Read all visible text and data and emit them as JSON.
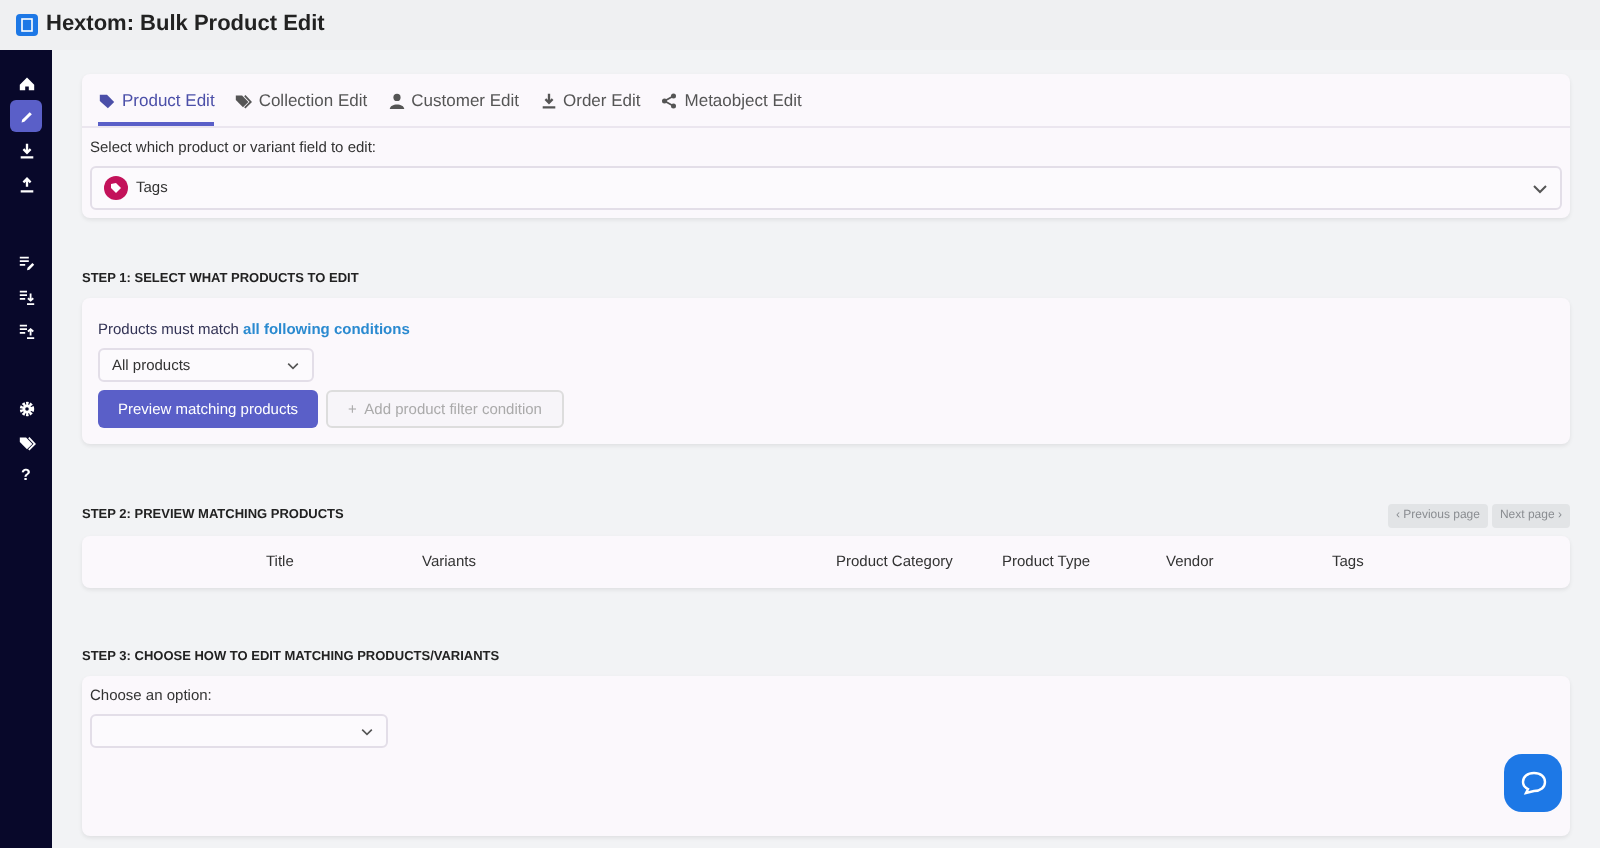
{
  "window": {
    "title": "Hextom: Bulk Product Edit"
  },
  "sidebar": {
    "items": [
      {
        "selected": false
      },
      {
        "selected": true
      },
      {
        "selected": false
      },
      {
        "selected": false
      },
      {
        "selected": false
      },
      {
        "selected": false
      },
      {
        "selected": false
      },
      {
        "selected": false
      },
      {
        "selected": false
      },
      {
        "selected": false,
        "text": "?"
      }
    ]
  },
  "tabs": [
    {
      "label": "Product Edit",
      "selected": true
    },
    {
      "label": "Collection Edit",
      "selected": false
    },
    {
      "label": "Customer Edit",
      "selected": false
    },
    {
      "label": "Order Edit",
      "selected": false
    },
    {
      "label": "Metaobject Edit",
      "selected": false
    }
  ],
  "field_picker": {
    "label": "Select which product or variant field to edit:",
    "value": "Tags"
  },
  "step1": {
    "heading": "STEP 1: SELECT WHAT PRODUCTS TO EDIT",
    "match_text": "Products must match **all following conditions**",
    "filter": "All products",
    "preview_button": "Preview matching products",
    "add_condition": {
      "label": "Add product filter condition",
      "icon": "+",
      "disabled": true
    }
  },
  "step2": {
    "heading": "STEP 2: PREVIEW MATCHING PRODUCTS",
    "pagination": [
      {
        "label": "‹ Previous page",
        "disabled": true
      },
      {
        "label": "Next page ›",
        "disabled": true
      }
    ],
    "table": {
      "columns": [
        "Title",
        "Variants",
        "Product Category",
        "Product Type",
        "Vendor",
        "Tags"
      ]
    }
  },
  "step3": {
    "heading": "STEP 3: CHOOSE HOW TO EDIT MATCHING PRODUCTS/VARIANTS",
    "label": "Choose an option:"
  }
}
